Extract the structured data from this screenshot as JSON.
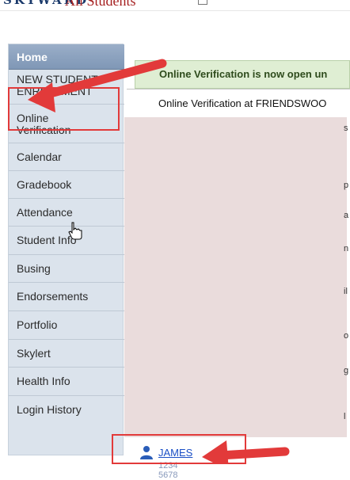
{
  "header": {
    "logo": "SKYWARD",
    "title": "All Students"
  },
  "sidebar": {
    "items": [
      {
        "label": "Home"
      },
      {
        "label": "NEW STUDENT\nENROLLMENT"
      },
      {
        "label": "Online\nVerification"
      },
      {
        "label": "Calendar"
      },
      {
        "label": "Gradebook"
      },
      {
        "label": "Attendance"
      },
      {
        "label": "Student Info"
      },
      {
        "label": "Busing"
      },
      {
        "label": "Endorsements"
      },
      {
        "label": "Portfolio"
      },
      {
        "label": "Skylert"
      },
      {
        "label": "Health Info"
      },
      {
        "label": "Login History"
      }
    ]
  },
  "content": {
    "banner": "Online Verification is now open un",
    "line": "Online Verification at FRIENDSWOO",
    "edge_chars": [
      "s",
      "p",
      "a",
      "n",
      "il",
      "o",
      "g",
      "l"
    ]
  },
  "student": {
    "name": "JAMES",
    "sub": "1234 5678"
  },
  "colors": {
    "accent_red": "#e23a3a",
    "link_blue": "#1a4fc6",
    "sidebar_bg": "#dbe3ec"
  }
}
